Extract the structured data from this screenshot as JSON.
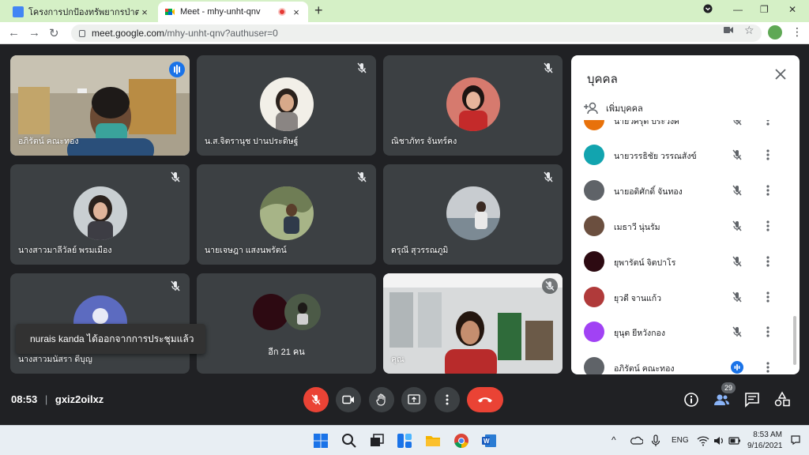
{
  "browser": {
    "tabs": [
      {
        "title": "โครงการปกป้องทรัพยากรป่าตะเคียนทอง",
        "active": false
      },
      {
        "title": "Meet - mhy-unht-qnv",
        "active": true
      }
    ],
    "url_host": "meet.google.com",
    "url_path": "/mhy-unht-qnv?authuser=0"
  },
  "tiles": [
    {
      "name": "อภิรัตน์ คณะทอง",
      "speaking": true
    },
    {
      "name": "น.ส.จิตรานุช ปานประดิษฐ์"
    },
    {
      "name": "ณิชาภัทร จันทร์คง"
    },
    {
      "name": "นางสาวมาลีวัลย์ พรมเมือง"
    },
    {
      "name": "นายเจษฎา แสงนพรัตน์"
    },
    {
      "name": "ดรุณี สุวรรณภูมิ"
    },
    {
      "name": "นางสาวมนัสรา ดีบุญ"
    },
    {
      "name": "อีก 21 คน"
    },
    {
      "name": "คุณ"
    }
  ],
  "toast": {
    "message": "nurais kanda ได้ออกจากการประชุมแล้ว"
  },
  "bottom": {
    "time": "08:53",
    "meeting_code": "gxiz2oilxz",
    "participant_count": "29"
  },
  "people_panel": {
    "title": "บุคคล",
    "add_people_label": "เพิ่มบุคคล",
    "participants": [
      {
        "name": "นายวิศรุต ประวงศ์",
        "avatar_color": "#e8710a"
      },
      {
        "name": "นายวรรธิชัย วรรณสังข์",
        "avatar_color": "#12a4af"
      },
      {
        "name": "นายอดิศักดิ์ จันทอง",
        "avatar_color": "#5f6368"
      },
      {
        "name": "เมธาวี นุ่นรัม",
        "avatar_color": "#6b4f3f"
      },
      {
        "name": "ยุพารัตน์ จิตปาโร",
        "avatar_color": "#2d0a12"
      },
      {
        "name": "ยุวดี จานแก้ว",
        "avatar_color": "#b03a3a"
      },
      {
        "name": "ยุนุต ยีหวังกอง",
        "avatar_color": "#a142f4"
      },
      {
        "name": "อภิรัตน์ คณะทอง",
        "avatar_color": "#5f6368"
      }
    ]
  },
  "taskbar": {
    "language": "ENG",
    "time": "8:53 AM",
    "date": "9/16/2021"
  },
  "colors": {
    "meet_bg": "#202124",
    "tile_bg": "#3c4043",
    "speaking_outline": "#8ab4f8",
    "end_call": "#ea4335",
    "tab_strip": "#d5f0c6"
  }
}
